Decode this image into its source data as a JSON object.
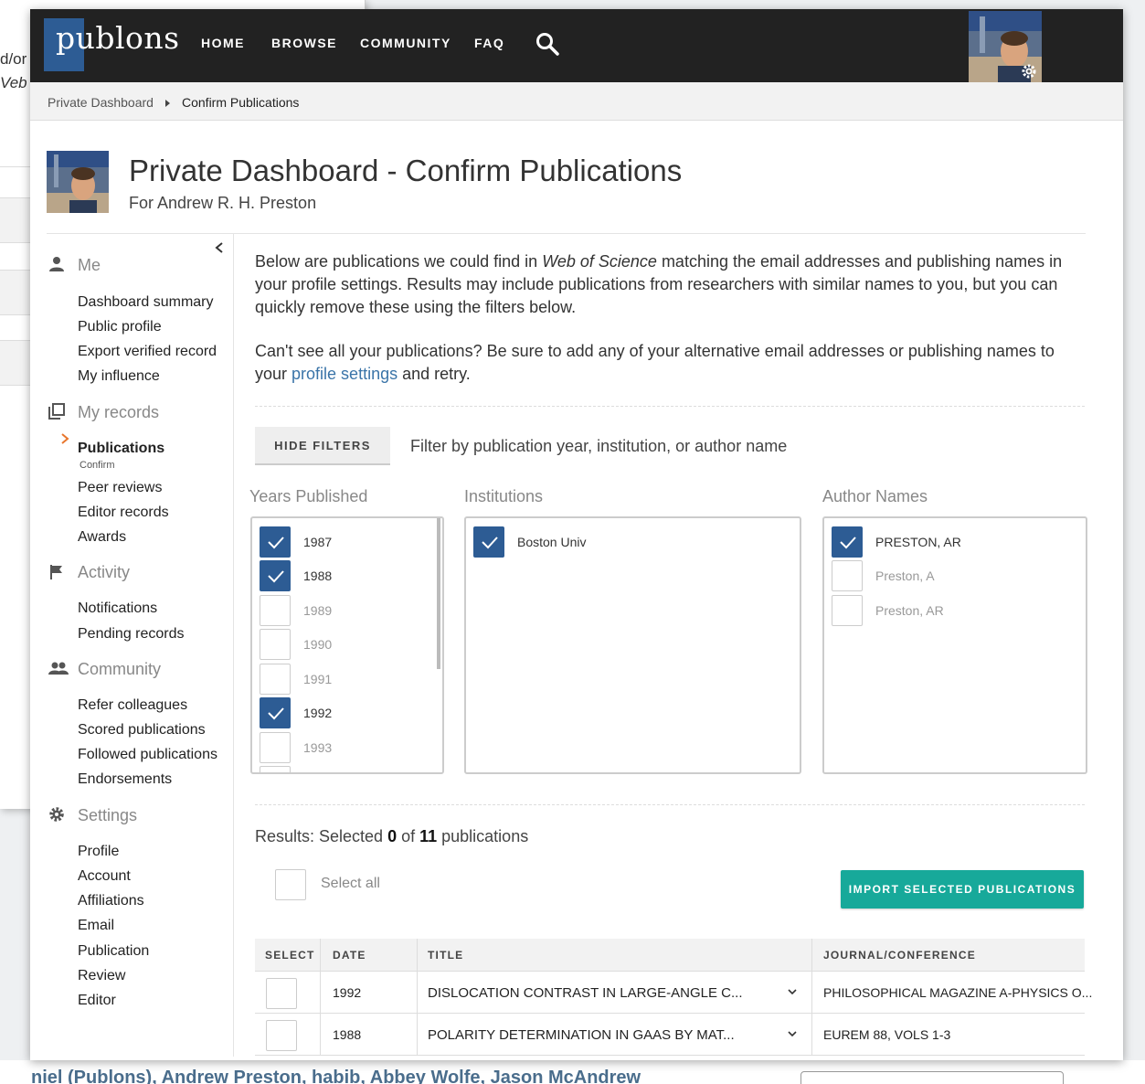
{
  "background": {
    "text_line1": "d/or",
    "text_line2": "Veb o",
    "bottom_text": "niel (Publons), Andrew Preston, habib, Abbey Wolfe, Jason McAndrew"
  },
  "nav": {
    "logo": "publons",
    "items": [
      "HOME",
      "BROWSE",
      "COMMUNITY",
      "FAQ"
    ],
    "search_icon": "search-icon",
    "profile_icon": "gear-icon"
  },
  "breadcrumb": {
    "items": [
      "Private Dashboard",
      "Confirm Publications"
    ]
  },
  "header": {
    "title": "Private Dashboard - Confirm Publications",
    "subtitle": "For Andrew R. H. Preston"
  },
  "sidebar": {
    "sections": [
      {
        "icon": "person-icon",
        "label": "Me",
        "items": [
          "Dashboard summary",
          "Public profile",
          "Export verified record",
          "My influence"
        ]
      },
      {
        "icon": "records-icon",
        "label": "My records",
        "items": [
          "Publications",
          "Peer reviews",
          "Editor records",
          "Awards"
        ],
        "active": "Publications",
        "active_sub": "Confirm"
      },
      {
        "icon": "flag-icon",
        "label": "Activity",
        "items": [
          "Notifications",
          "Pending records"
        ]
      },
      {
        "icon": "people-icon",
        "label": "Community",
        "items": [
          "Refer colleagues",
          "Scored publications",
          "Followed publications",
          "Endorsements"
        ]
      },
      {
        "icon": "gear-icon",
        "label": "Settings",
        "items": [
          "Profile",
          "Account",
          "Affiliations",
          "Email",
          "Publication",
          "Review",
          "Editor"
        ]
      }
    ]
  },
  "intro": {
    "p1_before": "Below are publications we could find in ",
    "p1_em": "Web of Science",
    "p1_after": " matching the email addresses and publishing names in your profile settings. Results may include publications from researchers with similar names to you, but you can quickly remove these using the filters below.",
    "p2_before": "Can't see all your publications? Be sure to add any of your alternative email addresses or publishing names to your ",
    "p2_link": "profile settings",
    "p2_after": " and retry."
  },
  "filters": {
    "hide_button": "HIDE FILTERS",
    "hint": "Filter by publication year, institution, or author name",
    "years": {
      "label": "Years Published",
      "options": [
        {
          "label": "1987",
          "checked": true
        },
        {
          "label": "1988",
          "checked": true
        },
        {
          "label": "1989",
          "checked": false
        },
        {
          "label": "1990",
          "checked": false
        },
        {
          "label": "1991",
          "checked": false
        },
        {
          "label": "1992",
          "checked": true
        },
        {
          "label": "1993",
          "checked": false
        }
      ]
    },
    "institutions": {
      "label": "Institutions",
      "options": [
        {
          "label": "Boston Univ",
          "checked": true
        }
      ]
    },
    "authors": {
      "label": "Author Names",
      "options": [
        {
          "label": "PRESTON, AR",
          "checked": true
        },
        {
          "label": "Preston, A",
          "checked": false
        },
        {
          "label": "Preston, AR",
          "checked": false
        }
      ]
    }
  },
  "results": {
    "prefix": "Results: Selected ",
    "selected": "0",
    "middle": " of ",
    "total": "11",
    "suffix": " publications",
    "select_all": "Select all",
    "import_button": "IMPORT SELECTED PUBLICATIONS"
  },
  "table": {
    "headers": [
      "SELECT",
      "DATE",
      "TITLE",
      "JOURNAL/CONFERENCE"
    ],
    "rows": [
      {
        "date": "1992",
        "title": "DISLOCATION CONTRAST IN LARGE-ANGLE C...",
        "journal": "PHILOSOPHICAL MAGAZINE A-PHYSICS O..."
      },
      {
        "date": "1988",
        "title": "POLARITY DETERMINATION IN GAAS BY MAT...",
        "journal": "EUREM 88, VOLS 1-3"
      }
    ]
  }
}
